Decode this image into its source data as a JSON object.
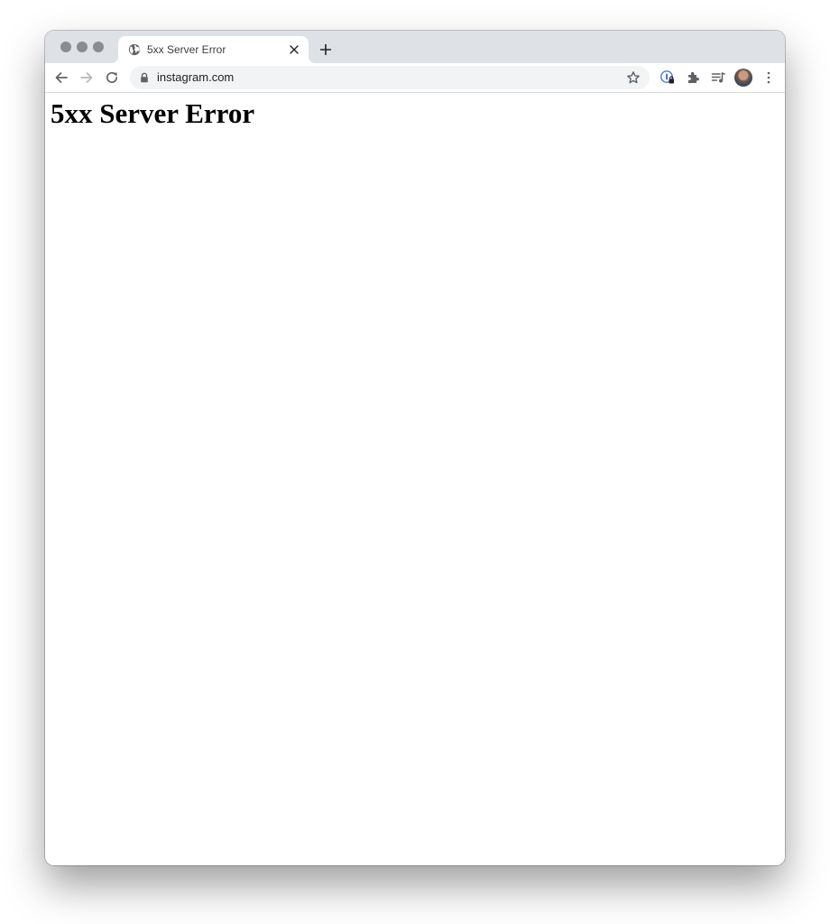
{
  "browser": {
    "tab": {
      "title": "5xx Server Error",
      "favicon": "globe-icon",
      "close_icon": "close-icon"
    },
    "new_tab_icon": "plus-icon",
    "toolbar": {
      "back_icon": "arrow-left-icon",
      "forward_icon": "arrow-right-icon",
      "reload_icon": "reload-icon",
      "address": "instagram.com",
      "lock_icon": "lock-icon",
      "bookmark_icon": "star-icon",
      "extensions": [
        "password-manager-icon",
        "puzzle-icon",
        "media-playlist-icon"
      ],
      "avatar": "profile-avatar",
      "menu_icon": "vertical-dots-icon"
    },
    "colors": {
      "tabstrip": "#dee1e6",
      "omnibox": "#f1f3f4",
      "icon": "#5f6368"
    }
  },
  "page": {
    "heading": "5xx Server Error"
  }
}
